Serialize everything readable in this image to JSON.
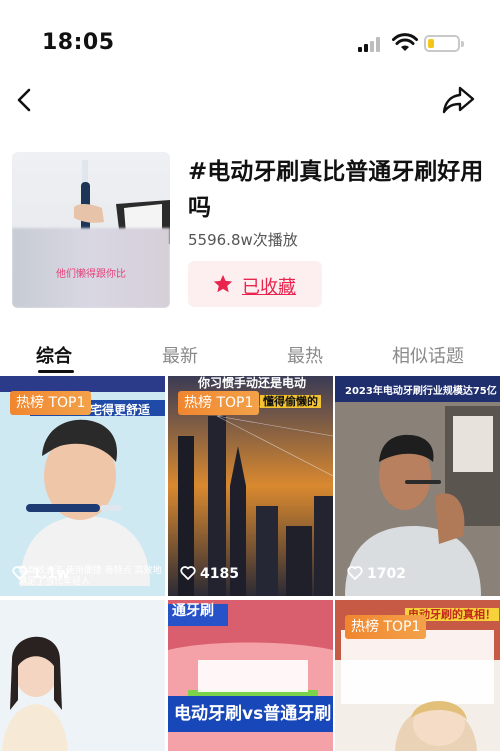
{
  "status_bar": {
    "time": "18:05",
    "battery_level": 0.2
  },
  "topic": {
    "title": "#电动牙刷真比普通牙刷好用吗",
    "play_count": "5596.8w次播放",
    "collect_label": "已收藏",
    "cover_caption": "他们懒得跟你比"
  },
  "tabs": [
    {
      "label": "综合",
      "active": true
    },
    {
      "label": "最新",
      "active": false
    },
    {
      "label": "最热",
      "active": false
    },
    {
      "label": "相似话题",
      "active": false
    }
  ],
  "cards": [
    {
      "badge": "热榜 TOP1",
      "likes": "1.1w",
      "banner": "宅得更舒适",
      "caption": "着高效清洁 使用便捷 等特点 高效地满足了当代年轻人"
    },
    {
      "badge": "热榜 TOP1",
      "likes": "4185",
      "banner": "你习惯手动还是电动",
      "sub_banner": "懂得偷懒的"
    },
    {
      "badge": "",
      "likes": "1702",
      "banner": "2023年电动牙刷行业规模达75亿"
    },
    {
      "badge": "",
      "likes": "",
      "banner": ""
    },
    {
      "badge": "",
      "likes": "",
      "banner": "通牙刷",
      "caption": "电动牙刷vs普通牙刷"
    },
    {
      "badge": "热榜 TOP1",
      "likes": "",
      "banner": "电动牙刷的真相！"
    }
  ],
  "colors": {
    "accent": "#e8254d",
    "badge": "#f0862f"
  },
  "icons": [
    "back-arrow-icon",
    "share-icon",
    "star-icon",
    "heart-icon",
    "signal-icon",
    "wifi-icon",
    "battery-icon"
  ]
}
